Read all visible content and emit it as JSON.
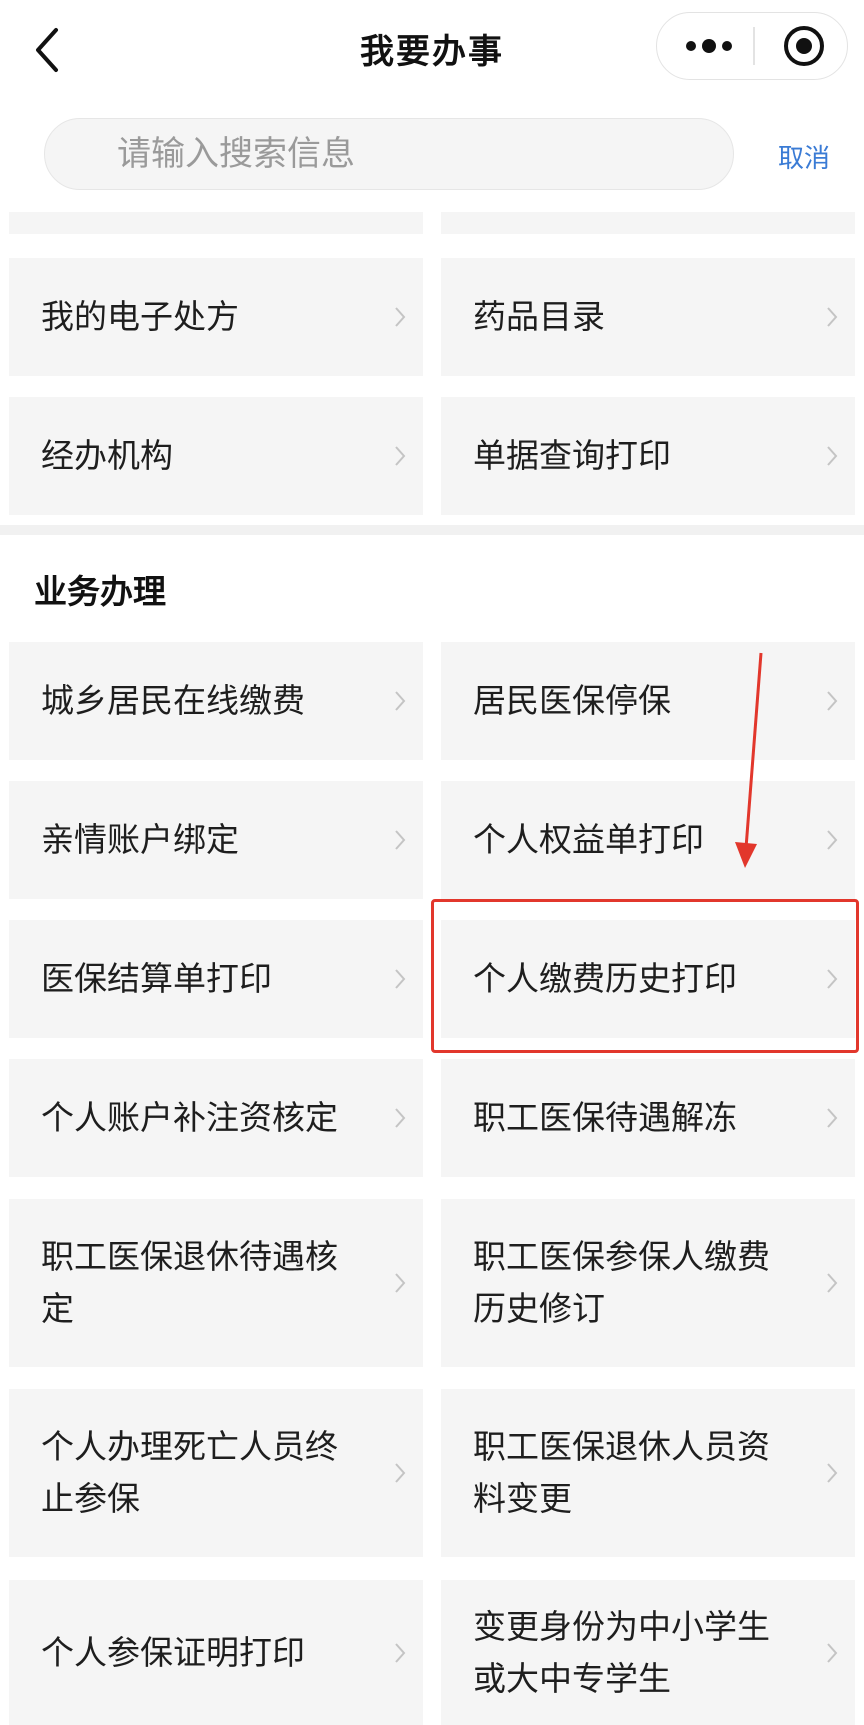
{
  "nav": {
    "title": "我要办事"
  },
  "search": {
    "placeholder": "请输入搜索信息",
    "value": "",
    "cancel_label": "取消"
  },
  "top_items": [
    {
      "label": "我的电子处方"
    },
    {
      "label": "药品目录"
    },
    {
      "label": "经办机构"
    },
    {
      "label": "单据查询打印"
    }
  ],
  "business_section": {
    "title": "业务办理",
    "items": [
      {
        "label": "城乡居民在线缴费"
      },
      {
        "label": "居民医保停保"
      },
      {
        "label": "亲情账户绑定"
      },
      {
        "label": "个人权益单打印"
      },
      {
        "label": "医保结算单打印"
      },
      {
        "label": "个人缴费历史打印"
      },
      {
        "label": "个人账户补注资核定"
      },
      {
        "label": "职工医保待遇解冻"
      },
      {
        "label": "职工医保退休待遇核定"
      },
      {
        "label": "职工医保参保人缴费历史修订"
      },
      {
        "label": "个人办理死亡人员终止参保"
      },
      {
        "label": "职工医保退休人员资料变更"
      },
      {
        "label": "个人参保证明打印"
      },
      {
        "label": "变更身份为中小学生或大中专学生"
      }
    ]
  },
  "colors": {
    "accent": "#3a7bd5",
    "highlight": "#e2372c",
    "tile_bg": "#f5f5f5"
  }
}
